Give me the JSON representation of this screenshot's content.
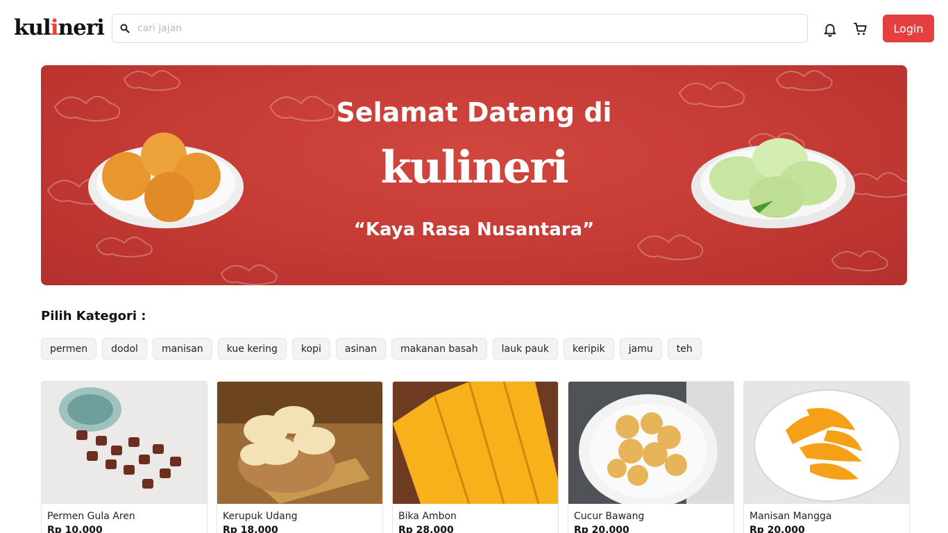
{
  "header": {
    "logo_prefix": "kul",
    "logo_i": "i",
    "logo_suffix": "neri",
    "search_placeholder": "cari jajan",
    "search_value": "",
    "login_label": "Login",
    "icons": {
      "search": "search-icon",
      "notification": "bell-icon",
      "cart": "cart-icon"
    }
  },
  "banner": {
    "title": "Selamat Datang di",
    "logo_text": "kulineri",
    "tagline": "“Kaya Rasa Nusantara”"
  },
  "category": {
    "title": "Pilih Kategori :",
    "items": [
      "permen",
      "dodol",
      "manisan",
      "kue kering",
      "kopi",
      "asinan",
      "makanan basah",
      "lauk pauk",
      "keripik",
      "jamu",
      "teh"
    ]
  },
  "products": [
    {
      "name": "Permen Gula Aren",
      "price": "Rp 10.000"
    },
    {
      "name": "Kerupuk Udang",
      "price": "Rp 18.000"
    },
    {
      "name": "Bika Ambon",
      "price": "Rp 28.000"
    },
    {
      "name": "Cucur Bawang",
      "price": "Rp 20.000"
    },
    {
      "name": "Manisan Mangga",
      "price": "Rp 20.000"
    }
  ],
  "colors": {
    "brand_red": "#e5403f",
    "banner_red": "#c43a34",
    "chip_bg": "#f3f3f3"
  }
}
